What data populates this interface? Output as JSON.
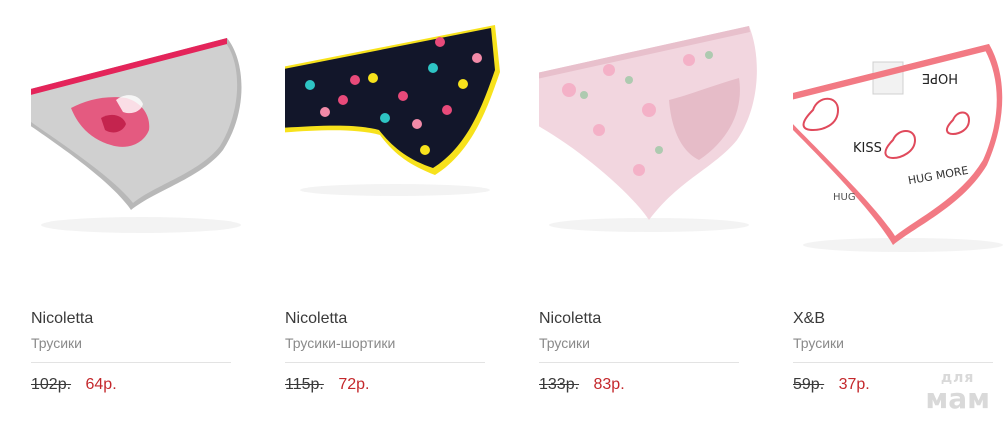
{
  "products": [
    {
      "brand": "Nicoletta",
      "category": "Трусики",
      "old_price": "102р.",
      "new_price": "64р.",
      "image": "grey-floral-briefs"
    },
    {
      "brand": "Nicoletta",
      "category": "Трусики-шортики",
      "old_price": "115р.",
      "new_price": "72р.",
      "image": "navy-polka-dot-shorts"
    },
    {
      "brand": "Nicoletta",
      "category": "Трусики",
      "old_price": "133р.",
      "new_price": "83р.",
      "image": "pink-floral-briefs"
    },
    {
      "brand": "X&B",
      "category": "Трусики",
      "old_price": "59р.",
      "new_price": "37р.",
      "image": "white-pink-print-briefs"
    }
  ],
  "image_text": {
    "hope": "HOPE",
    "kiss": "KISS",
    "hug_more": "HUG MORE",
    "hug": "HUG"
  },
  "watermark": {
    "line1": "для",
    "line2": "мам"
  },
  "colors": {
    "price_new": "#c4282c",
    "brand_text": "#3a3a3a",
    "category_text": "#8a8a8a",
    "divider": "#e3e3e3"
  }
}
